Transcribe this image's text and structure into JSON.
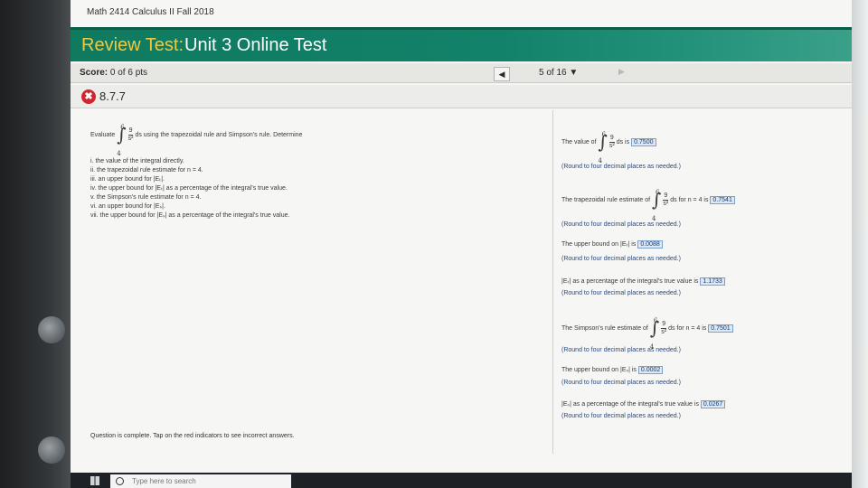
{
  "course": "Math 2414 Calculus II Fall 2018",
  "title": {
    "lead": "Review Test:",
    "rest": "Unit 3 Online Test"
  },
  "score": {
    "label": "Score:",
    "value": "0 of 6 pts"
  },
  "nav": {
    "position": "5 of 16 ▼",
    "prev_icon": "◀",
    "next_icon": "▶"
  },
  "question": {
    "status_icon": "✖",
    "number": "8.7.7"
  },
  "problem": {
    "lead": "Evaluate",
    "upper": "6",
    "lower": "4",
    "numerator": "9",
    "denominator": "s²",
    "rest": "ds using the trapezoidal rule and Simpson's rule. Determine",
    "parts": [
      "i. the value of the integral directly.",
      "ii. the trapezoidal rule estimate for n = 4.",
      "iii. an upper bound for |Eₜ|.",
      "iv. the upper bound for |Eₜ| as a percentage of the integral's true value.",
      "v. the Simpson's rule estimate for n = 4.",
      "vi. an upper bound for |Eₛ|.",
      "vii. the upper bound for |Eₛ| as a percentage of the integral's true value."
    ]
  },
  "answers": {
    "round_note": "(Round to four decimal places as needed.)",
    "a1": {
      "pre": "The value of",
      "post": "ds is",
      "value": "0.7500"
    },
    "a2": {
      "pre": "The trapezoidal rule estimate of",
      "post": "ds for n = 4 is",
      "value": "0.7541"
    },
    "a3": {
      "pre": "The upper bound on |Eₜ| is",
      "value": "0.0088"
    },
    "a4": {
      "pre": "|Eₜ| as a percentage of the integral's true value is",
      "value": "1.1733"
    },
    "a5": {
      "pre": "The Simpson's rule estimate of",
      "post": "ds for n = 4 is",
      "value": "0.7501"
    },
    "a6": {
      "pre": "The upper bound on |Eₛ| is",
      "value": "0.0002"
    },
    "a7": {
      "pre": "|Eₛ| as a percentage of the integral's true value is",
      "value": "0.0267"
    }
  },
  "footer_note": "Question is complete. Tap on the red indicators to see incorrect answers.",
  "taskbar": {
    "search_placeholder": "Type here to search"
  },
  "colors": {
    "header": "#12826a",
    "accent": "#f0c940",
    "error": "#d1262f",
    "answer_box": "#dbe8f7"
  }
}
